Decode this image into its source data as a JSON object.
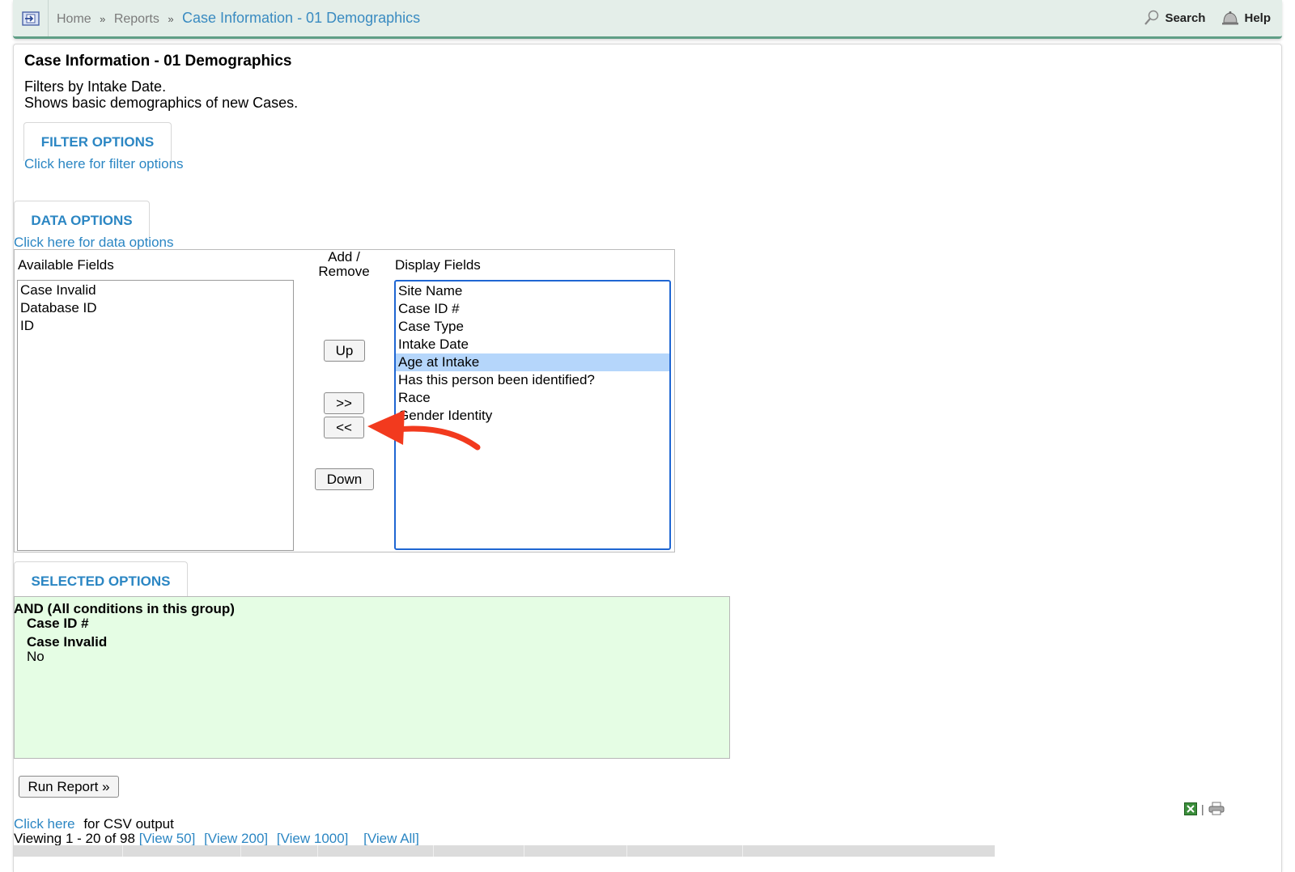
{
  "topbar": {
    "breadcrumb": [
      "Home",
      "Reports"
    ],
    "breadcrumb_sep": "»",
    "current": "Case Information - 01 Demographics",
    "search_label": "Search",
    "help_label": "Help"
  },
  "report": {
    "title": "Case Information - 01 Demographics",
    "desc_line1": "Filters by Intake Date.",
    "desc_line2": "Shows basic demographics of new Cases."
  },
  "filter_tab": {
    "label": "FILTER OPTIONS",
    "link": "Click here for filter options"
  },
  "data_tab": {
    "label": "DATA OPTIONS",
    "link": "Click here for data options"
  },
  "fields": {
    "available_label": "Available Fields",
    "add_remove_label_1": "Add /",
    "add_remove_label_2": "Remove",
    "display_label": "Display Fields",
    "available": [
      "Case Invalid",
      "Database ID",
      "ID"
    ],
    "display": [
      "Site Name",
      "Case ID #",
      "Case Type",
      "Intake Date",
      "Age at Intake",
      "Has this person been identified?",
      "Race",
      "Gender Identity"
    ],
    "display_selected": "Age at Intake",
    "up_label": "Up",
    "add_label": ">>",
    "remove_label": "<<",
    "down_label": "Down"
  },
  "selected_tab": {
    "label": "SELECTED OPTIONS"
  },
  "selected": {
    "group": "AND (All conditions in this group)",
    "cond1": "Case ID #",
    "cond2": "Case Invalid",
    "cond2_value": "No"
  },
  "run_label": "Run Report »",
  "csv": {
    "link": "Click here",
    "rest": "for CSV output"
  },
  "viewing": {
    "text": "Viewing 1 - 20 of 98",
    "links": [
      "[View 50]",
      "[View 200]",
      "[View 1000]",
      "[View All]"
    ]
  },
  "colors": {
    "accent": "#2b86c3",
    "topbar_bg": "#e4eee9",
    "selected_bg": "#e5fde4",
    "arrow": "#f23a1e"
  }
}
